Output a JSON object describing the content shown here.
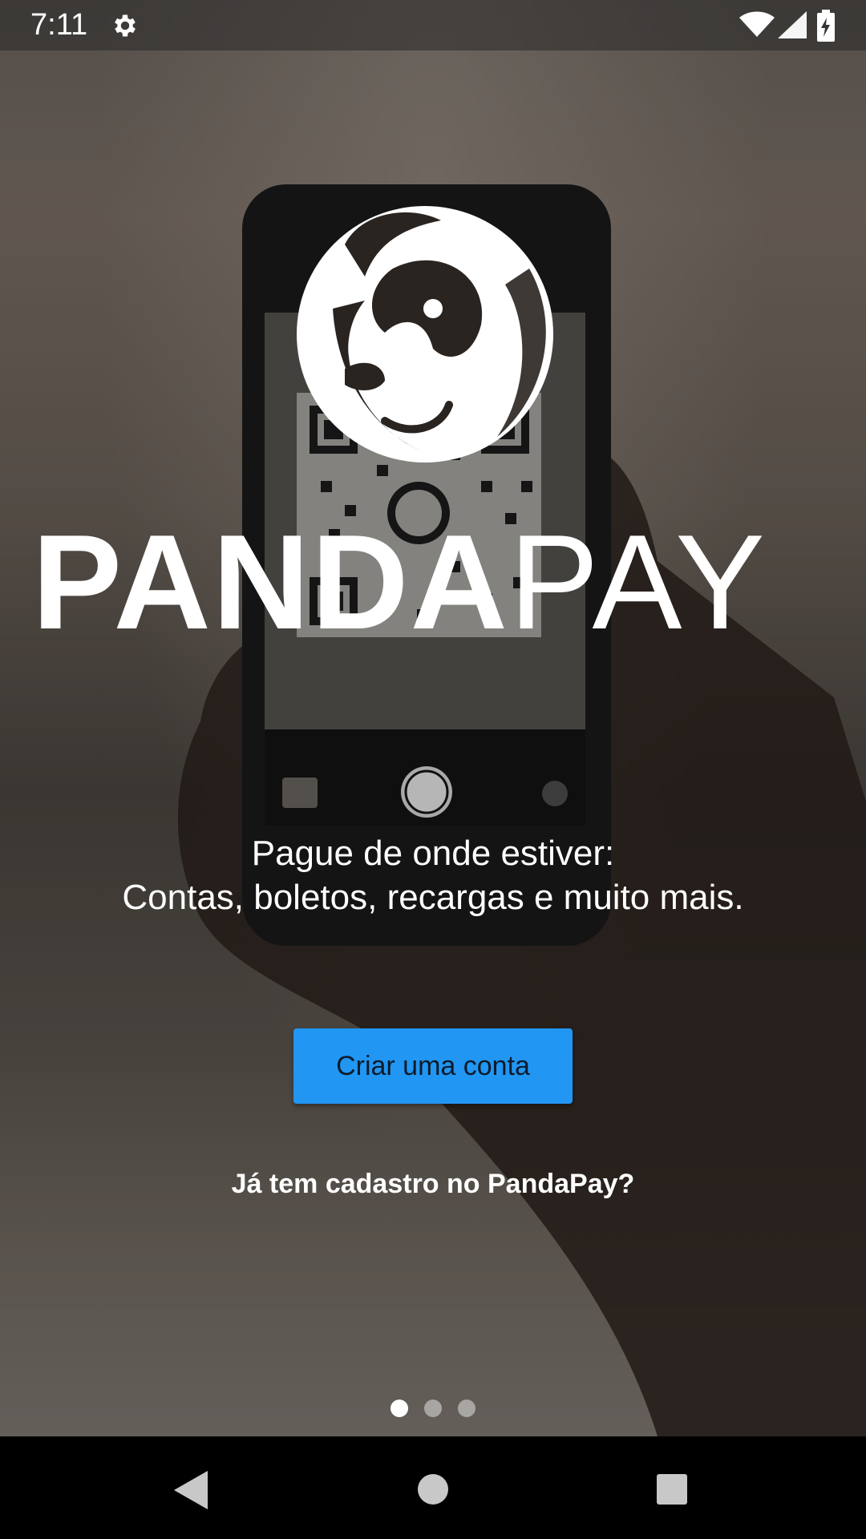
{
  "status_bar": {
    "time": "7:11",
    "icons": [
      "settings-icon",
      "wifi-icon",
      "cell-signal-icon",
      "battery-charging-icon"
    ]
  },
  "logo": {
    "word_bold": "PANDA",
    "word_light": "PAY",
    "mark_icon": "panda-head-logo"
  },
  "tagline": {
    "line1": "Pague de onde estiver:",
    "line2": "Contas, boletos, recargas e muito mais."
  },
  "actions": {
    "create_account": "Criar uma conta",
    "login": "Já tem cadastro no PandaPay?"
  },
  "pager": {
    "count": 3,
    "active": 1
  },
  "colors": {
    "primary_button": "#2196f3",
    "text": "#ffffff"
  },
  "nav_bar": {
    "icons": [
      "back-icon",
      "home-icon",
      "recents-icon"
    ]
  }
}
